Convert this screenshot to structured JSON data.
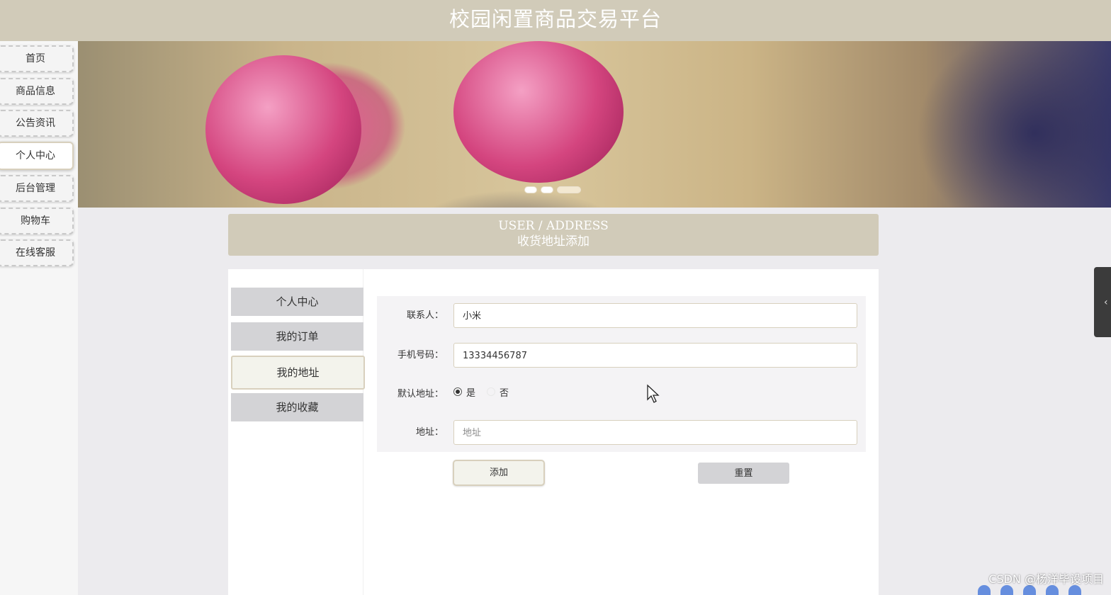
{
  "header": {
    "title": "校园闲置商品交易平台"
  },
  "leftnav": {
    "items": [
      {
        "label": "首页"
      },
      {
        "label": "商品信息"
      },
      {
        "label": "公告资讯"
      },
      {
        "label": "个人中心"
      },
      {
        "label": "后台管理"
      },
      {
        "label": "购物车"
      },
      {
        "label": "在线客服"
      }
    ],
    "active_index": 3
  },
  "banner": {
    "slide_count": 3,
    "active_slide": 3
  },
  "section": {
    "title_en": "USER / ADDRESS",
    "title_cn": "收货地址添加"
  },
  "sidemenu": {
    "items": [
      {
        "label": "个人中心"
      },
      {
        "label": "我的订单"
      },
      {
        "label": "我的地址"
      },
      {
        "label": "我的收藏"
      }
    ],
    "active_index": 2
  },
  "form": {
    "contact": {
      "label": "联系人：",
      "value": "小米"
    },
    "phone": {
      "label": "手机号码：",
      "value": "13334456787"
    },
    "default": {
      "label": "默认地址：",
      "option_yes": "是",
      "option_no": "否",
      "selected": "是"
    },
    "address": {
      "label": "地址：",
      "placeholder": "地址",
      "value": ""
    },
    "add_label": "添加",
    "reset_label": "重置"
  },
  "watermark": "CSDN @杨洋毕设项目",
  "colors": {
    "accent": "#d1cbb9",
    "menu_bg": "#d3d3d6",
    "active_bg": "#f3f3ec"
  }
}
